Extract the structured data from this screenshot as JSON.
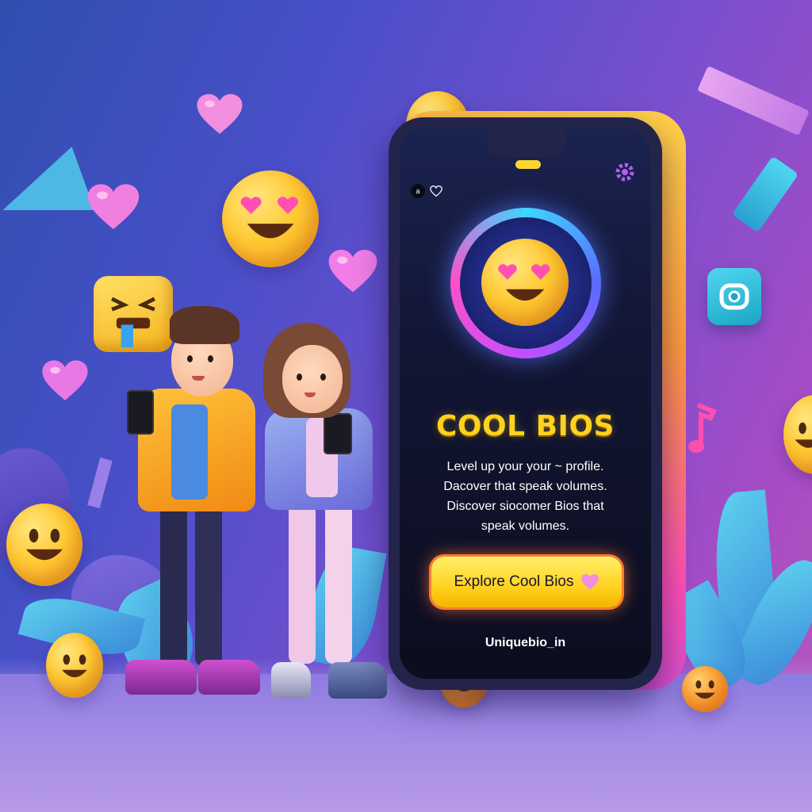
{
  "phone_screen": {
    "status_label": "a",
    "title": "COOL BIOS",
    "description_lines": [
      "Level up your your ~ profile.",
      "Dacover that speak volumes.",
      "Discover siocomer Bios that",
      "speak volumes."
    ],
    "cta_label": "Explore Cool Bios",
    "site": "Uniquebio_in"
  },
  "icons": {
    "gear": "gear-icon",
    "cta_heart": "heart-icon",
    "social_icon": "app-icon",
    "music_note": "music-note-icon"
  },
  "colors": {
    "title": "#ffd21f",
    "cta_bg": "#ffd21f",
    "heart": "#f06bd6",
    "emoji": "#ffc933",
    "phone_frame": "#23244a"
  }
}
